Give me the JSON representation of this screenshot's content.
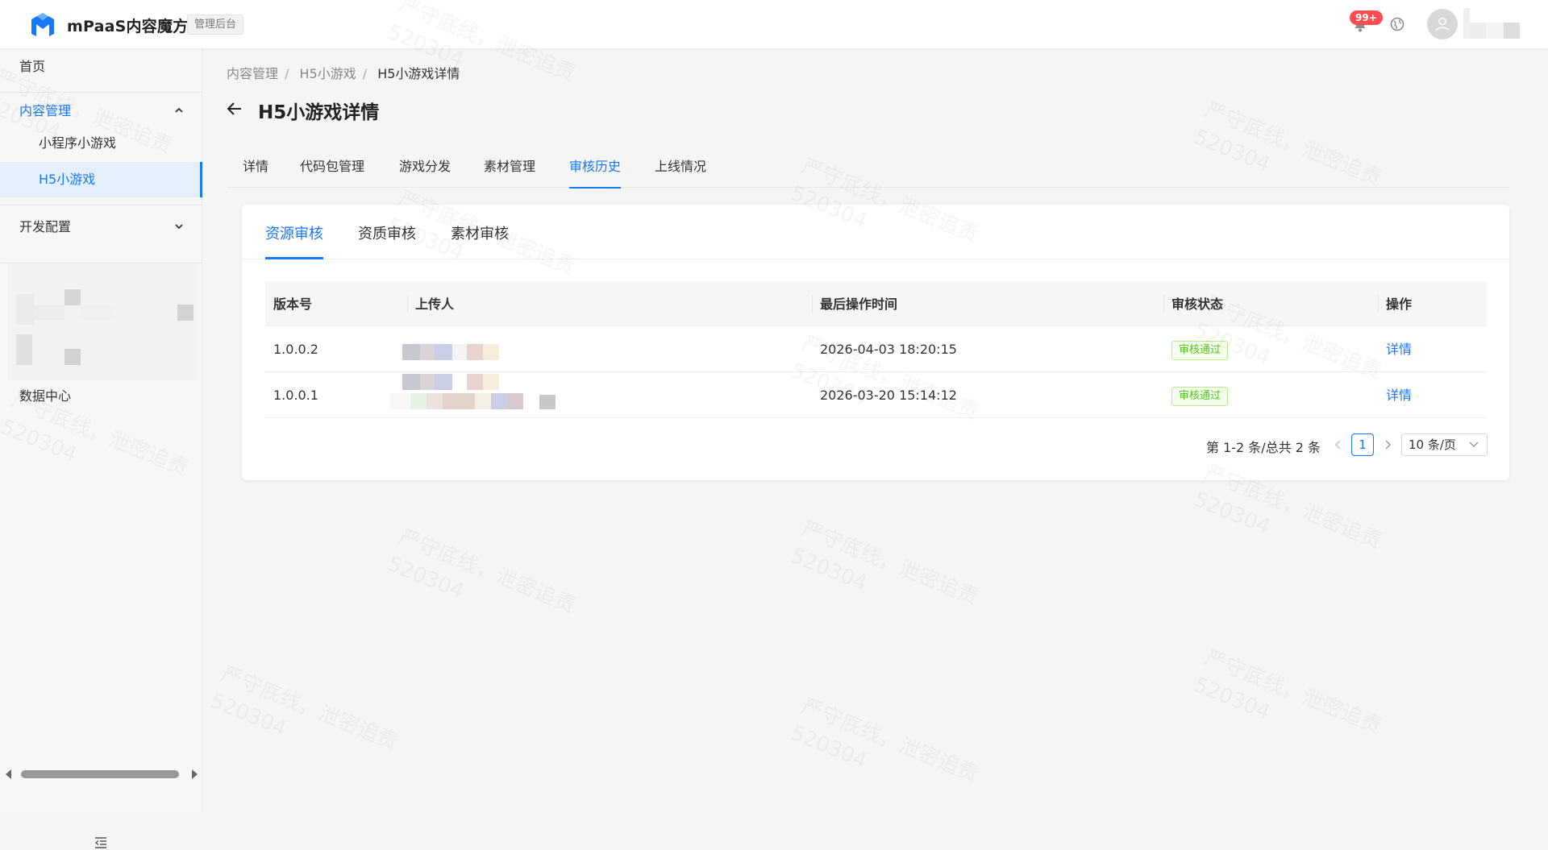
{
  "header": {
    "app_title": "mPaaS内容魔方",
    "admin_tag": "管理后台",
    "notification_badge": "99+",
    "icons": [
      "logo-icon",
      "bell-icon",
      "globe-icon",
      "user-avatar-icon"
    ]
  },
  "sidebar": {
    "items": [
      {
        "label": "首页"
      },
      {
        "label": "内容管理",
        "expanded": true
      },
      {
        "label": "小程序小游戏"
      },
      {
        "label": "H5小游戏",
        "selected": true
      },
      {
        "label": "开发配置",
        "expanded": false
      },
      {
        "label": "数据中心"
      }
    ]
  },
  "breadcrumb": [
    "内容管理",
    "H5小游戏",
    "H5小游戏详情"
  ],
  "page": {
    "title": "H5小游戏详情"
  },
  "tabs": [
    "详情",
    "代码包管理",
    "游戏分发",
    "素材管理",
    "审核历史",
    "上线情况"
  ],
  "active_tab": "审核历史",
  "subtabs": [
    "资源审核",
    "资质审核",
    "素材审核"
  ],
  "active_subtab": "资源审核",
  "table": {
    "columns": [
      "版本号",
      "上传人",
      "最后操作时间",
      "审核状态",
      "操作"
    ],
    "rows": [
      {
        "version": "1.0.0.2",
        "time": "2026-04-03 18:20:15",
        "status": "审核通过",
        "action": "详情"
      },
      {
        "version": "1.0.0.1",
        "time": "2026-03-20 15:14:12",
        "status": "审核通过",
        "action": "详情"
      }
    ]
  },
  "pagination": {
    "total_text": "第 1-2 条/总共 2 条",
    "current_page": "1",
    "page_size": "10 条/页"
  },
  "watermark": {
    "line1": "严守底线，泄密追责",
    "line2": "520304"
  },
  "colors": {
    "accent": "#1677ff",
    "success": "#52c41a",
    "badge": "#ff4d4f"
  }
}
